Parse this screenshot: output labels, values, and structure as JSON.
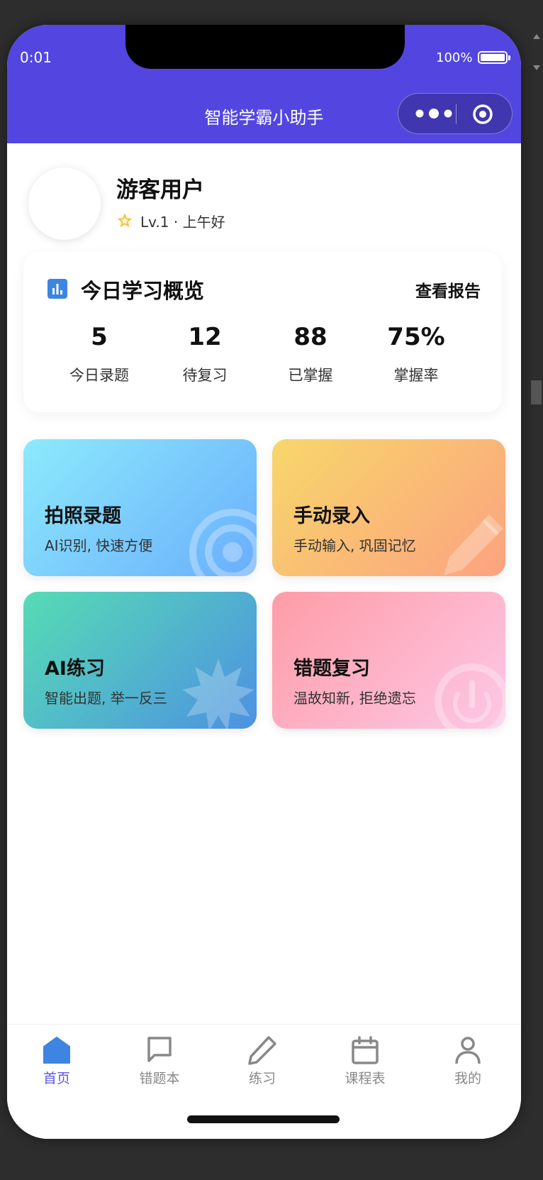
{
  "status_bar": {
    "time": "0:01",
    "battery_percent": "100%"
  },
  "navbar": {
    "title": "智能学霸小助手"
  },
  "profile": {
    "name": "游客用户",
    "level_line": "Lv.1 · 上午好"
  },
  "overview": {
    "title": "今日学习概览",
    "link": "查看报告",
    "stats": [
      {
        "value": "5",
        "label": "今日录题"
      },
      {
        "value": "12",
        "label": "待复习"
      },
      {
        "value": "88",
        "label": "已掌握"
      },
      {
        "value": "75%",
        "label": "掌握率"
      }
    ]
  },
  "cards": [
    {
      "title": "拍照录题",
      "subtitle": "AI识别, 快速方便",
      "icon": "target-icon"
    },
    {
      "title": "手动录入",
      "subtitle": "手动输入, 巩固记忆",
      "icon": "pencil-icon"
    },
    {
      "title": "AI练习",
      "subtitle": "智能出题, 举一反三",
      "icon": "badge-icon"
    },
    {
      "title": "错题复习",
      "subtitle": "温故知新, 拒绝遗忘",
      "icon": "power-icon"
    }
  ],
  "tabbar": {
    "active_color": "#5d55e6",
    "items": [
      {
        "label": "首页",
        "icon": "home-icon"
      },
      {
        "label": "错题本",
        "icon": "chat-square-icon"
      },
      {
        "label": "练习",
        "icon": "pencil-icon"
      },
      {
        "label": "课程表",
        "icon": "calendar-icon"
      },
      {
        "label": "我的",
        "icon": "user-icon"
      }
    ]
  },
  "theme": {
    "primary": "#5346e0"
  }
}
